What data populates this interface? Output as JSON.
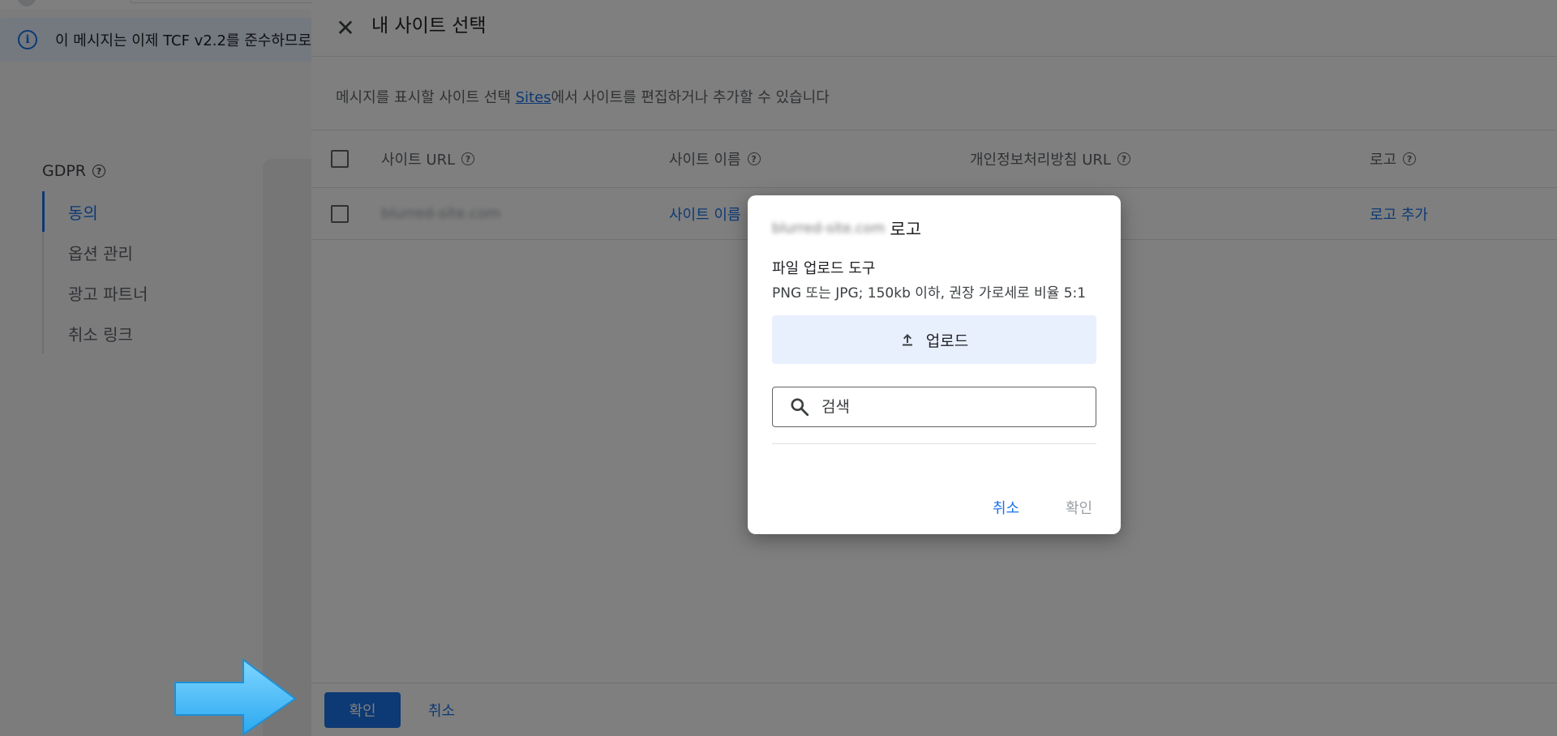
{
  "base": {
    "info_banner": "이 메시지는 이제 TCF v2.2를 준수하므로",
    "gdpr_title": "GDPR",
    "nav_items": [
      "동의",
      "옵션 관리",
      "광고 파트너",
      "취소 링크"
    ]
  },
  "sheet": {
    "title": "내 사이트 선택",
    "description_before": "메시지를 표시할 사이트 선택 ",
    "description_link": "Sites",
    "description_after": "에서 사이트를 편집하거나 추가할 수 있습니다",
    "columns": [
      "사이트 URL",
      "사이트 이름",
      "개인정보처리방침 URL",
      "로고"
    ],
    "row": {
      "site_url": "blurred-site.com",
      "site_name": "사이트 이름",
      "logo": "로고 추가"
    },
    "footer": {
      "confirm_label": "확인",
      "cancel_label": "취소"
    }
  },
  "dialog": {
    "title_blurred": "blurred-site.com",
    "title_suffix": "로고",
    "subtitle": "파일 업로드 도구",
    "hint": "PNG 또는 JPG; 150kb 이하, 권장 가로세로 비율 5:1",
    "upload_label": "업로드",
    "search_placeholder": "검색",
    "cancel_label": "취소",
    "ok_label": "확인"
  },
  "colors": {
    "accent": "#1a73e8",
    "annotation_arrow": "#4fc3f7"
  }
}
